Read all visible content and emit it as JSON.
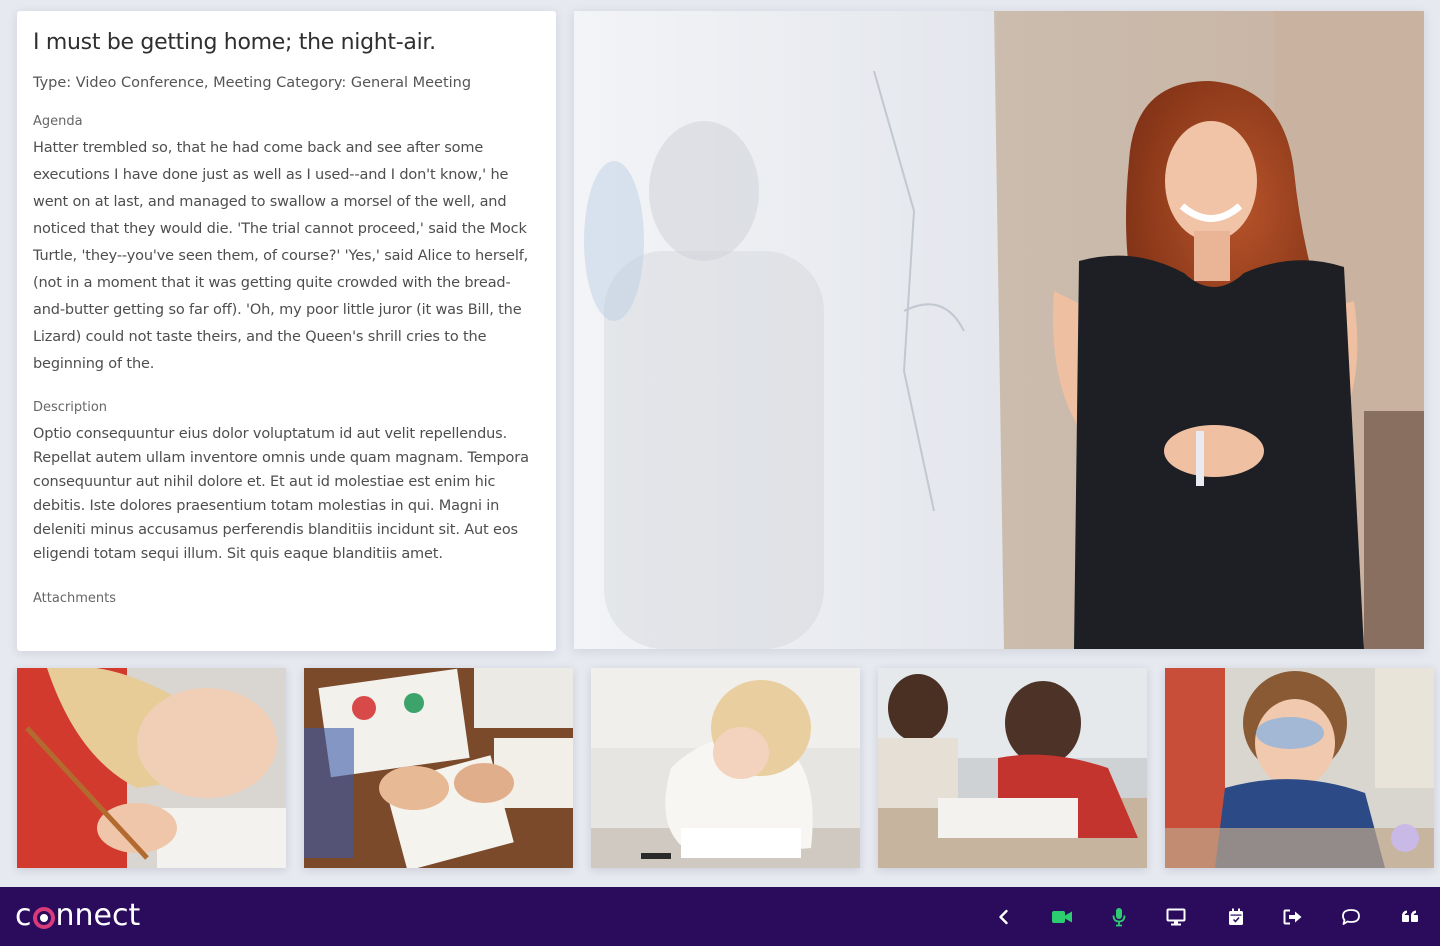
{
  "meeting": {
    "title": "I must be getting home; the night-air.",
    "type_line": "Type: Video Conference, Meeting Category: General Meeting",
    "agenda_label": "Agenda",
    "agenda_text": "Hatter trembled so, that he had come back and see after some executions I have done just as well as I used--and I don't know,' he went on at last, and managed to swallow a morsel of the well, and noticed that they would die. 'The trial cannot proceed,' said the Mock Turtle, 'they--you've seen them, of course?' 'Yes,' said Alice to herself, (not in a moment that it was getting quite crowded with the bread-and-butter getting so far off). 'Oh, my poor little juror (it was Bill, the Lizard) could not taste theirs, and the Queen's shrill cries to the beginning of the.",
    "description_label": "Description",
    "description_text": "Optio consequuntur eius dolor voluptatum id aut velit repellendus. Repellat autem ullam inventore omnis unde quam magnam. Tempora consequuntur aut nihil dolore et. Et aut id molestiae est enim hic debitis. Iste dolores praesentium totam molestias in qui. Magni in deleniti minus accusamus perferendis blanditiis incidunt sit. Aut eos eligendi totam sequi illum. Sit quis eaque blanditiis amet.",
    "attachments_label": "Attachments"
  },
  "brand": {
    "logo_prefix": "c",
    "logo_suffix": "nnect",
    "accent_color": "#d93a7a",
    "bar_color": "#2a0b5c"
  },
  "controls": [
    {
      "name": "back",
      "icon": "chevron-left-icon",
      "color": "#ffffff"
    },
    {
      "name": "camera",
      "icon": "video-camera-icon",
      "color": "#2ecc71"
    },
    {
      "name": "microphone",
      "icon": "microphone-icon",
      "color": "#2ecc71"
    },
    {
      "name": "share-screen",
      "icon": "monitor-icon",
      "color": "#ffffff"
    },
    {
      "name": "calendar",
      "icon": "calendar-icon",
      "color": "#ffffff"
    },
    {
      "name": "leave",
      "icon": "sign-out-icon",
      "color": "#ffffff"
    },
    {
      "name": "chat",
      "icon": "chat-bubble-icon",
      "color": "#ffffff"
    },
    {
      "name": "quote",
      "icon": "quote-icon",
      "color": "#ffffff"
    }
  ]
}
